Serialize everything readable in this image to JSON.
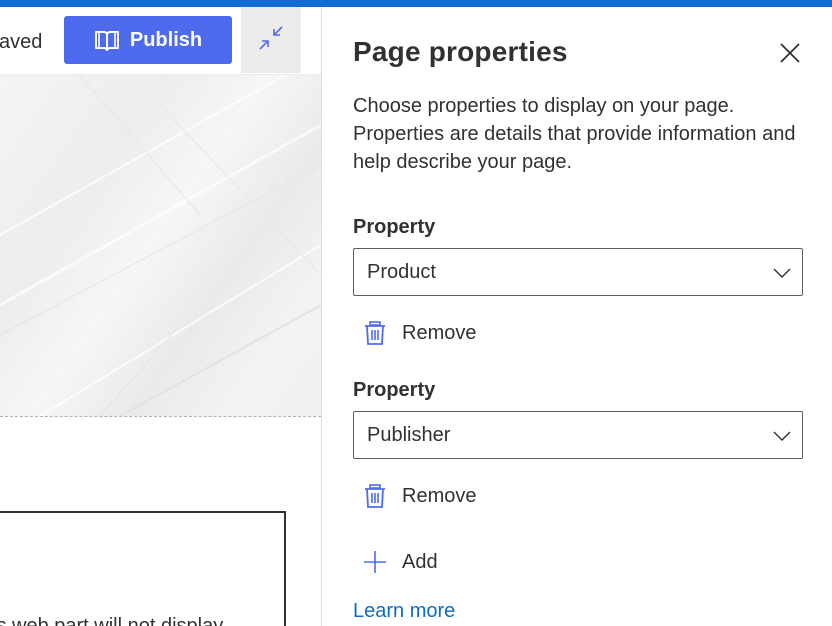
{
  "toolbar": {
    "saved_text": "aved",
    "publish_label": "Publish",
    "publish_icon": "book-icon",
    "collapse_icon": "collapse-icon"
  },
  "editor": {
    "webpart_text": "is web part will not display"
  },
  "panel": {
    "title": "Page properties",
    "close_icon": "close-icon",
    "description": "Choose properties to display on your page. Properties are details that provide information and help describe your page.",
    "properties": [
      {
        "label": "Property",
        "value": "Product",
        "remove_label": "Remove"
      },
      {
        "label": "Property",
        "value": "Publisher",
        "remove_label": "Remove"
      }
    ],
    "add_label": "Add",
    "learn_more_label": "Learn more"
  },
  "colors": {
    "accent": "#0f6cd4",
    "publish_button": "#4f6bed",
    "icon_blue": "#4f6bed",
    "link": "#0f6cbd",
    "text": "#323130"
  }
}
